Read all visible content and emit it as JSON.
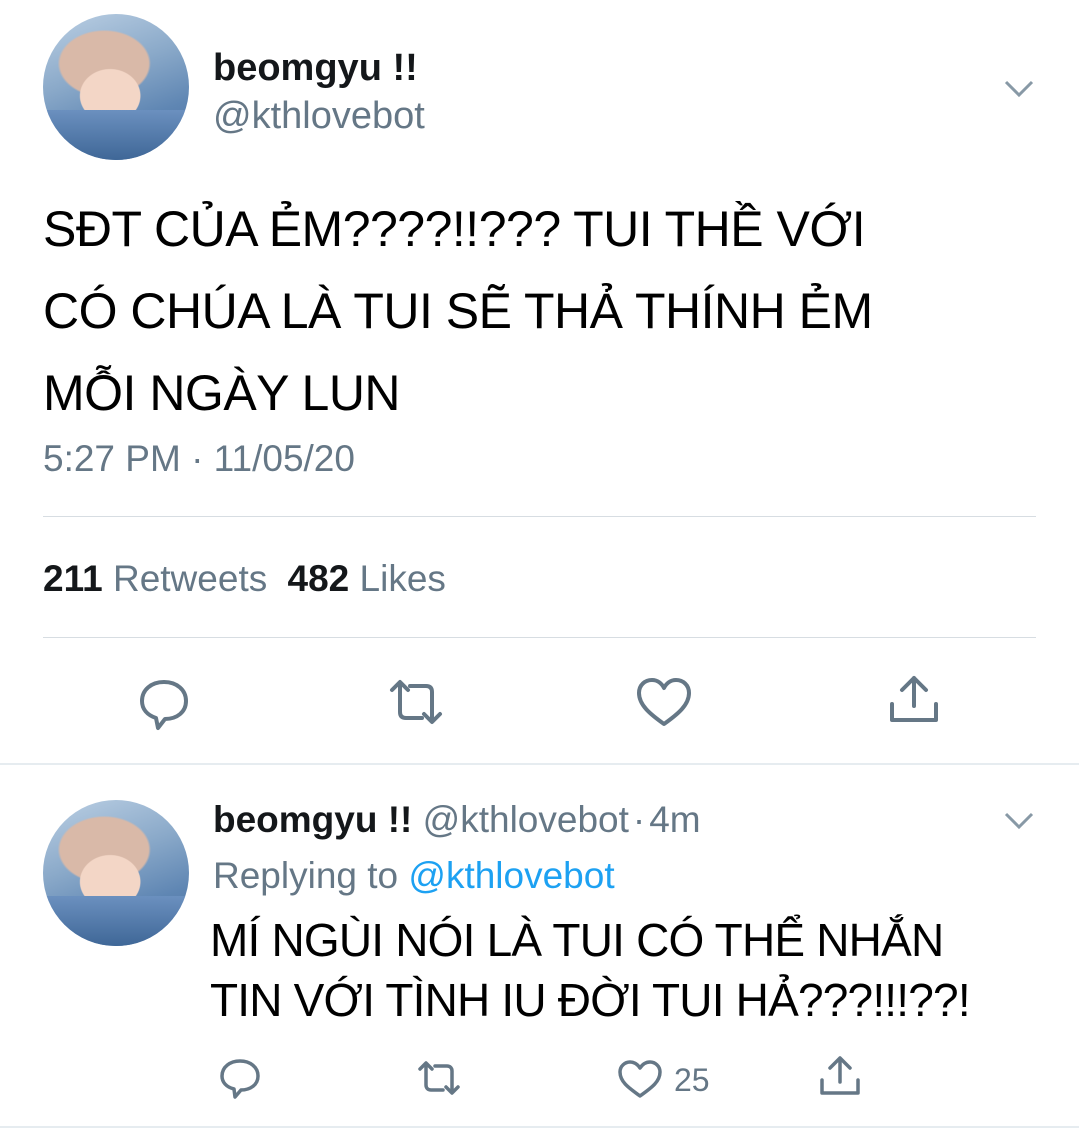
{
  "main_tweet": {
    "display_name": "beomgyu !!",
    "handle": "@kthlovebot",
    "text_lines": [
      "SĐT CỦA ẺM????!!??? TUI THỀ VỚI",
      "CÓ CHÚA LÀ TUI SẼ THẢ THÍNH ẺM",
      "MỖI NGÀY LUN"
    ],
    "timestamp": "5:27 PM · 11/05/20",
    "retweet_count": "211",
    "retweet_label": "Retweets",
    "like_count": "482",
    "like_label": "Likes",
    "icons": [
      "chevron-down-icon",
      "reply-icon",
      "retweet-icon",
      "heart-icon",
      "share-icon"
    ]
  },
  "reply_tweet": {
    "display_name": "beomgyu !!",
    "handle": "@kthlovebot",
    "separator": "·",
    "age": "4m",
    "replying_prefix": "Replying to",
    "replying_to": "@kthlovebot",
    "text_lines": [
      "MÍ NGÙI NÓI LÀ TUI CÓ THỂ NHẮN",
      "TIN VỚI TÌNH IU ĐỜI TUI HẢ???!!!??!"
    ],
    "like_count": "25",
    "icons": [
      "chevron-down-icon",
      "reply-icon",
      "retweet-icon",
      "heart-icon",
      "share-icon"
    ]
  },
  "colors": {
    "text": "#14171a",
    "muted": "#657786",
    "link": "#1da1f2",
    "divider": "#d7dde2"
  }
}
